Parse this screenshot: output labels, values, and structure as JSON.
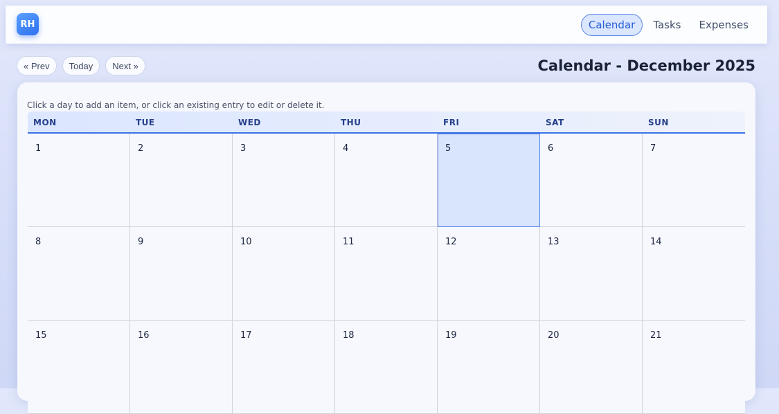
{
  "app": {
    "logo_text": "RH"
  },
  "nav": {
    "items": [
      {
        "label": "Calendar",
        "active": true
      },
      {
        "label": "Tasks",
        "active": false
      },
      {
        "label": "Expenses",
        "active": false
      }
    ]
  },
  "controls": {
    "prev_label": "« Prev",
    "today_label": "Today",
    "next_label": "Next »"
  },
  "page": {
    "title": "Calendar - December 2025"
  },
  "calendar": {
    "hint": "Click a day to add an item, or click an existing entry to edit or delete it.",
    "weekdays": [
      "MON",
      "TUE",
      "WED",
      "THU",
      "FRI",
      "SAT",
      "SUN"
    ],
    "today": "5",
    "days": [
      "1",
      "2",
      "3",
      "4",
      "5",
      "6",
      "7",
      "8",
      "9",
      "10",
      "11",
      "12",
      "13",
      "14",
      "15",
      "16",
      "17",
      "18",
      "19",
      "20",
      "21"
    ]
  },
  "colors": {
    "accent": "#2d6ff0",
    "today_bg": "#d9e4fd",
    "nav_active_bg": "#dbe6ff"
  }
}
